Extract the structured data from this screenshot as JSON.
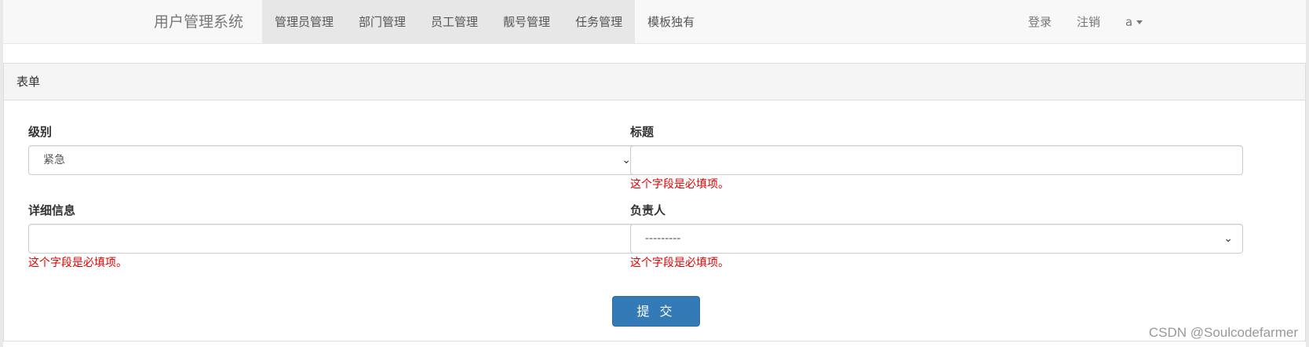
{
  "navbar": {
    "brand": "用户管理系统",
    "items": [
      {
        "label": "管理员管理",
        "active": true
      },
      {
        "label": "部门管理",
        "active": true
      },
      {
        "label": "员工管理",
        "active": true
      },
      {
        "label": "靓号管理",
        "active": true
      },
      {
        "label": "任务管理",
        "active": true
      },
      {
        "label": "模板独有",
        "active": false
      }
    ],
    "right": {
      "login": "登录",
      "logout": "注销",
      "user": "a"
    }
  },
  "panel": {
    "heading": "表单"
  },
  "form": {
    "level": {
      "label": "级别",
      "value": "紧急"
    },
    "title": {
      "label": "标题",
      "value": "",
      "error": "这个字段是必填项。"
    },
    "detail": {
      "label": "详细信息",
      "value": "",
      "error": "这个字段是必填项。"
    },
    "owner": {
      "label": "负责人",
      "value": "---------",
      "error": "这个字段是必填项。"
    },
    "submit_label": "提 交"
  },
  "watermark": "CSDN @Soulcodefarmer",
  "colors": {
    "primary": "#337ab7",
    "error": "#e00000",
    "navbar_bg": "#f8f8f8"
  }
}
